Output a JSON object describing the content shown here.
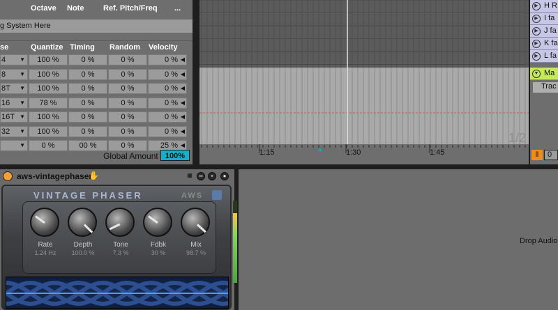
{
  "groove_header": {
    "octave": "Octave",
    "note": "Note",
    "ref_pitch": "Ref. Pitch/Freq",
    "more": "..."
  },
  "tuning_system_text": "g System Here",
  "columns": {
    "base": "se",
    "quantize": "Quantize",
    "timing": "Timing",
    "random": "Random",
    "velocity": "Velocity"
  },
  "groove_rows": [
    {
      "base": "4",
      "quantize": "100 %",
      "timing": "0 %",
      "random": "0 %",
      "velocity": "0 %"
    },
    {
      "base": "8",
      "quantize": "100 %",
      "timing": "0 %",
      "random": "0 %",
      "velocity": "0 %"
    },
    {
      "base": "8T",
      "quantize": "100 %",
      "timing": "0 %",
      "random": "0 %",
      "velocity": "0 %"
    },
    {
      "base": "16",
      "quantize": "78 %",
      "timing": "0 %",
      "random": "0 %",
      "velocity": "0 %"
    },
    {
      "base": "16T",
      "quantize": "100 %",
      "timing": "0 %",
      "random": "0 %",
      "velocity": "0 %"
    },
    {
      "base": "32",
      "quantize": "100 %",
      "timing": "0 %",
      "random": "0 %",
      "velocity": "0 %"
    },
    {
      "base": "",
      "quantize": "0 %",
      "timing": "00 %",
      "random": "0 %",
      "velocity": "25 %"
    }
  ],
  "global_amount": {
    "label": "Global Amount",
    "value": "100%"
  },
  "arrangement": {
    "page": "1/2",
    "time_labels": [
      "1:15",
      "1:30",
      "1:45"
    ]
  },
  "tracks": [
    {
      "name": "H R",
      "type": "normal"
    },
    {
      "name": "I fa",
      "type": "normal"
    },
    {
      "name": "J fa",
      "type": "normal"
    },
    {
      "name": "K fa",
      "type": "normal"
    },
    {
      "name": "L fa",
      "type": "normal"
    },
    {
      "name": "Ma",
      "type": "master"
    }
  ],
  "track_sub": "Trac",
  "bottom_field": "0",
  "device": {
    "name": "aws-vintagephaser",
    "title": "VINTAGE PHASER",
    "brand": "AWS",
    "knobs": [
      {
        "label": "Rate",
        "value": "1.24 Hz",
        "level": 0.3
      },
      {
        "label": "Depth",
        "value": "100.0 %",
        "level": 1.0
      },
      {
        "label": "Tone",
        "value": "7.3 %",
        "level": 0.07
      },
      {
        "label": "Fdbk",
        "value": "30 %",
        "level": 0.3
      },
      {
        "label": "Mix",
        "value": "98.7 %",
        "level": 0.99
      }
    ]
  },
  "drop_text": "Drop Audio",
  "colors": {
    "accent": "#13b0ca",
    "master_track": "#c5e85c",
    "normal_track": "#c8c6e6",
    "power": "#f5a037"
  }
}
